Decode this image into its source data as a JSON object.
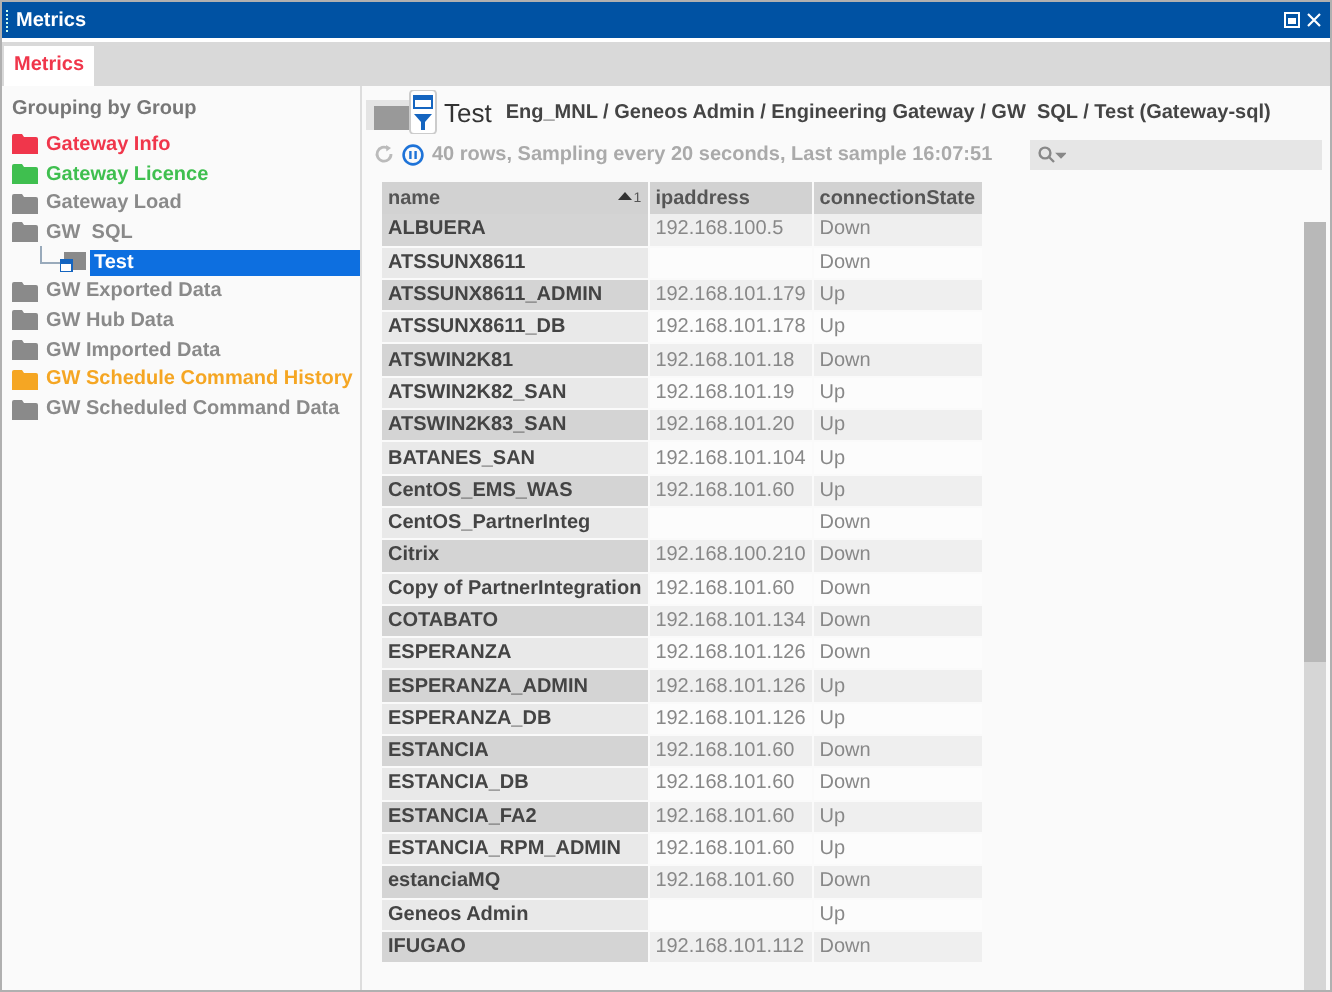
{
  "window": {
    "title": "Metrics"
  },
  "tabs": [
    {
      "label": "Metrics",
      "selected": true
    }
  ],
  "sidebar": {
    "heading": "Grouping by Group",
    "items": [
      {
        "label": "Gateway Info",
        "color": "#f0364b",
        "selected": false,
        "kind": "folder"
      },
      {
        "label": "Gateway Licence",
        "color": "#3fbf4f",
        "selected": false,
        "kind": "folder"
      },
      {
        "label": "Gateway Load",
        "color": "#8a8a8a",
        "selected": false,
        "kind": "folder"
      },
      {
        "label": "GW  SQL",
        "color": "#8a8a8a",
        "selected": false,
        "kind": "folder",
        "children": [
          {
            "label": "Test",
            "color": "#8a8a8a",
            "selected": true,
            "kind": "view"
          }
        ]
      },
      {
        "label": "GW Exported Data",
        "color": "#8a8a8a",
        "selected": false,
        "kind": "folder"
      },
      {
        "label": "GW Hub Data",
        "color": "#8a8a8a",
        "selected": false,
        "kind": "folder"
      },
      {
        "label": "GW Imported Data",
        "color": "#8a8a8a",
        "selected": false,
        "kind": "folder"
      },
      {
        "label": "GW Schedule Command History",
        "color": "#f5a623",
        "selected": false,
        "kind": "folder"
      },
      {
        "label": "GW Scheduled Command Data",
        "color": "#8a8a8a",
        "selected": false,
        "kind": "folder"
      }
    ]
  },
  "view": {
    "title": "Test",
    "path": "Eng_MNL / Geneos Admin / Engineering Gateway / GW  SQL / Test (Gateway-sql)",
    "status": "40 rows, Sampling every 20 seconds, Last sample 16:07:51"
  },
  "table": {
    "columns": [
      {
        "label": "name",
        "sort_order": "1"
      },
      {
        "label": "ipaddress"
      },
      {
        "label": "connectionState"
      }
    ],
    "rows": [
      [
        "ALBUERA",
        "192.168.100.5",
        "Down"
      ],
      [
        "ATSSUNX8611",
        "",
        "Down"
      ],
      [
        "ATSSUNX8611_ADMIN",
        "192.168.101.179",
        "Up"
      ],
      [
        "ATSSUNX8611_DB",
        "192.168.101.178",
        "Up"
      ],
      [
        "ATSWIN2K81",
        "192.168.101.18",
        "Down"
      ],
      [
        "ATSWIN2K82_SAN",
        "192.168.101.19",
        "Up"
      ],
      [
        "ATSWIN2K83_SAN",
        "192.168.101.20",
        "Up"
      ],
      [
        "BATANES_SAN",
        "192.168.101.104",
        "Up"
      ],
      [
        "CentOS_EMS_WAS",
        "192.168.101.60",
        "Up"
      ],
      [
        "CentOS_PartnerInteg",
        "",
        "Down"
      ],
      [
        "Citrix",
        "192.168.100.210",
        "Down"
      ],
      [
        "Copy of PartnerIntegration",
        "192.168.101.60",
        "Down"
      ],
      [
        "COTABATO",
        "192.168.101.134",
        "Down"
      ],
      [
        "ESPERANZA",
        "192.168.101.126",
        "Down"
      ],
      [
        "ESPERANZA_ADMIN",
        "192.168.101.126",
        "Up"
      ],
      [
        "ESPERANZA_DB",
        "192.168.101.126",
        "Up"
      ],
      [
        "ESTANCIA",
        "192.168.101.60",
        "Down"
      ],
      [
        "ESTANCIA_DB",
        "192.168.101.60",
        "Down"
      ],
      [
        "ESTANCIA_FA2",
        "192.168.101.60",
        "Up"
      ],
      [
        "ESTANCIA_RPM_ADMIN",
        "192.168.101.60",
        "Up"
      ],
      [
        "estanciaMQ",
        "192.168.101.60",
        "Down"
      ],
      [
        "Geneos Admin",
        "",
        "Up"
      ],
      [
        "IFUGAO",
        "192.168.101.112",
        "Down"
      ]
    ]
  }
}
